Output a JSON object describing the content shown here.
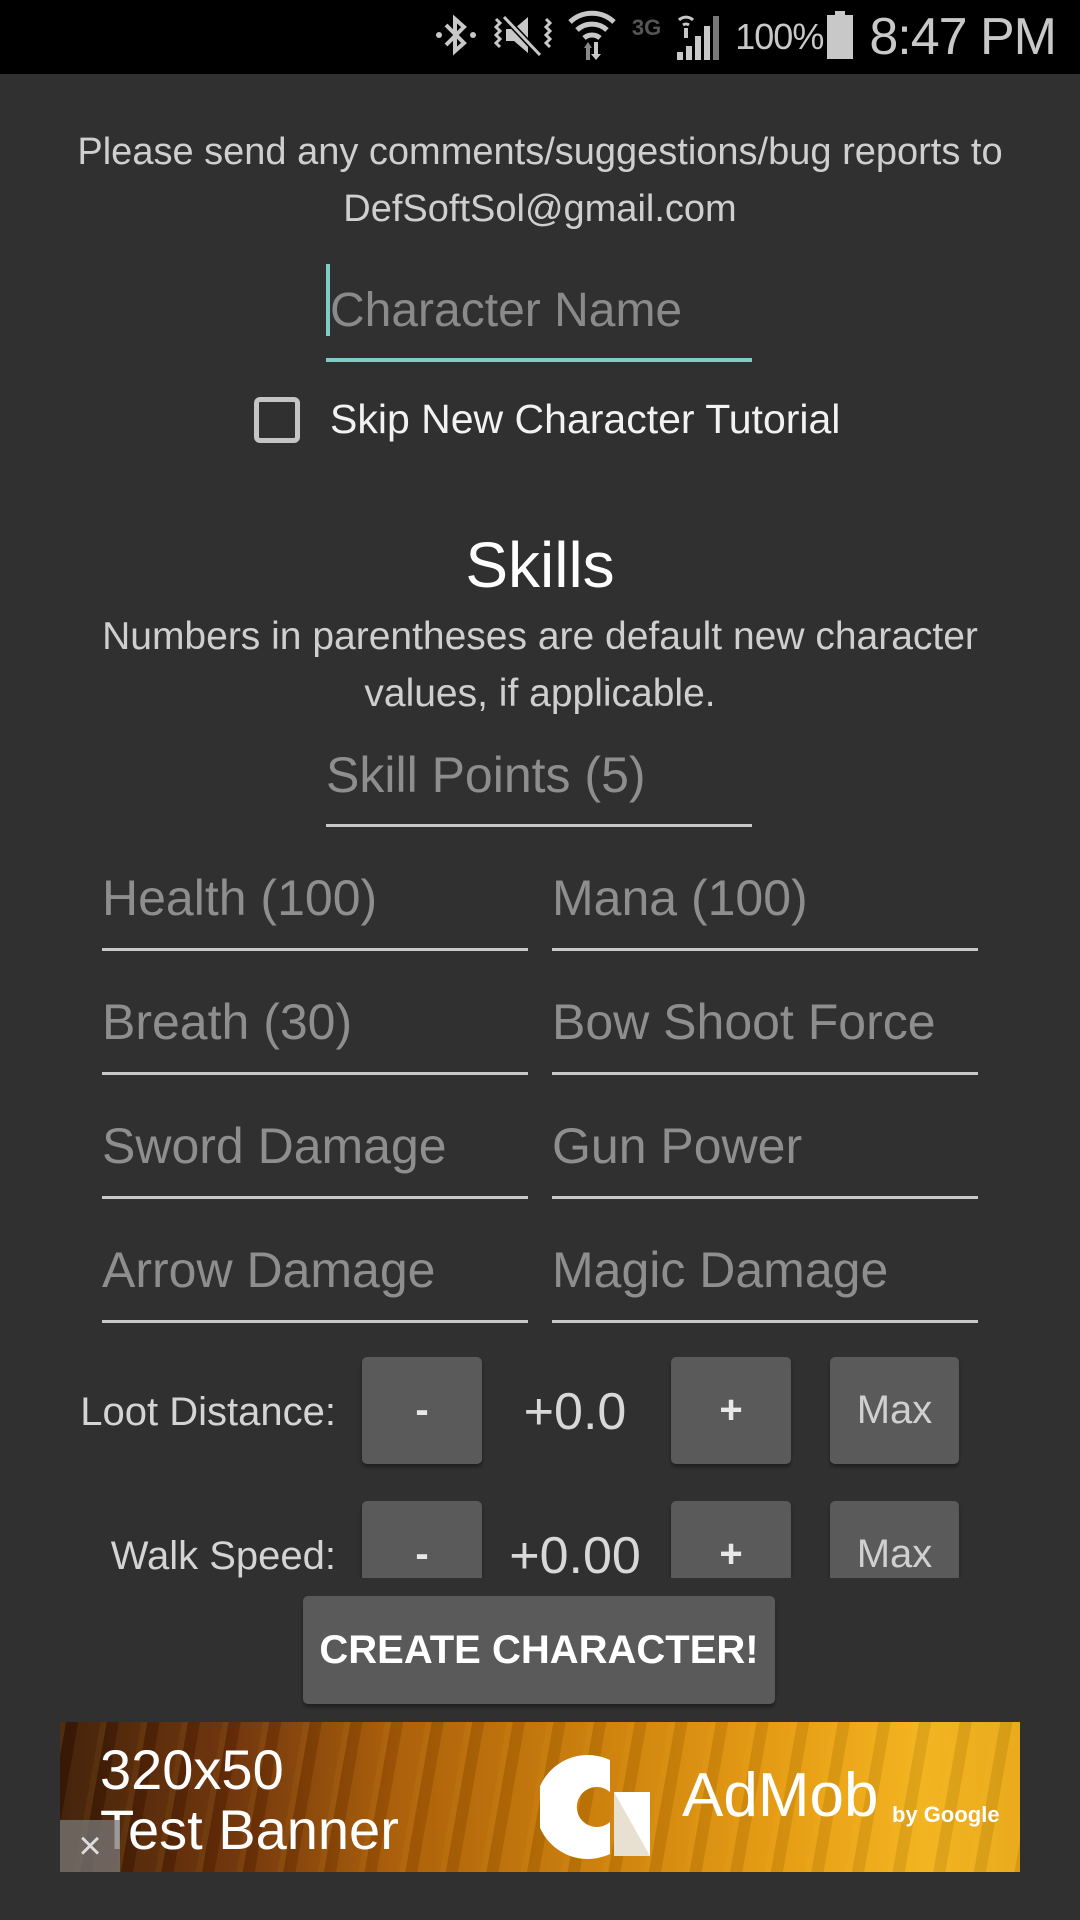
{
  "status_bar": {
    "icons": [
      "bluetooth-icon",
      "vibrate-mute-icon",
      "wifi-icon",
      "network-3g-icon",
      "signal-icon",
      "battery-icon"
    ],
    "network_type": "3G",
    "battery_percent": "100%",
    "time": "8:47 PM"
  },
  "info_text": "Please send any comments/suggestions/bug reports to DefSoftSol@gmail.com",
  "character_name": {
    "value": "",
    "placeholder": "Character Name"
  },
  "skip_tutorial": {
    "label": "Skip New Character Tutorial",
    "checked": false
  },
  "skills": {
    "title": "Skills",
    "description": "Numbers in parentheses are default new character values, if applicable.",
    "skill_points": {
      "value": "",
      "placeholder": "Skill Points (5)"
    },
    "fields": [
      {
        "placeholder": "Health (100)",
        "value": ""
      },
      {
        "placeholder": "Mana (100)",
        "value": ""
      },
      {
        "placeholder": "Breath (30)",
        "value": ""
      },
      {
        "placeholder": "Bow Shoot Force",
        "value": ""
      },
      {
        "placeholder": "Sword Damage",
        "value": ""
      },
      {
        "placeholder": "Gun Power",
        "value": ""
      },
      {
        "placeholder": "Arrow Damage",
        "value": ""
      },
      {
        "placeholder": "Magic Damage",
        "value": ""
      }
    ]
  },
  "steppers": [
    {
      "label": "Loot Distance:",
      "minus": "-",
      "value": "+0.0",
      "plus": "+",
      "max": "Max"
    },
    {
      "label": "Walk Speed:",
      "minus": "-",
      "value": "+0.00",
      "plus": "+",
      "max": "Max"
    }
  ],
  "create_button": "CREATE CHARACTER!",
  "ad_banner": {
    "size_text": "320x50",
    "banner_text": "Test Banner",
    "brand": "AdMob",
    "brand_sub": "by Google",
    "close": "×"
  },
  "colors": {
    "background": "#303030",
    "accent": "#80cbc4",
    "button": "#5a5a5a"
  }
}
